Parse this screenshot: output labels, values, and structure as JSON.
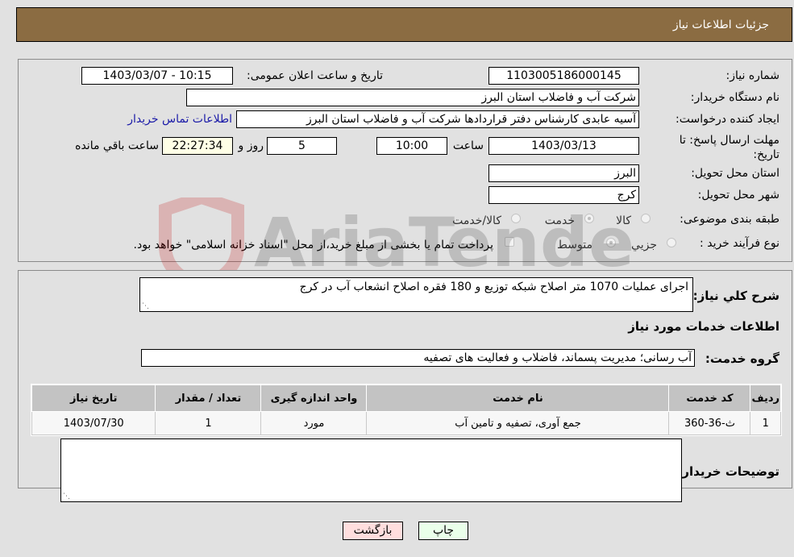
{
  "header": {
    "title": "جزئیات اطلاعات نیاز"
  },
  "details": {
    "need_number_label": "شماره نیاز:",
    "need_number": "1103005186000145",
    "announce_label": "تاریخ و ساعت اعلان عمومی:",
    "announce_value": "1403/03/07 - 10:15",
    "buyer_org_label": "نام دستگاه خریدار:",
    "buyer_org": "شرکت آب و فاضلاب استان البرز",
    "creator_label": "ایجاد کننده درخواست:",
    "creator": "آسیه عابدی کارشناس دفتر قراردادها شرکت آب و فاضلاب استان البرز",
    "contact_link": "اطلاعات تماس خریدار",
    "deadline_label": "مهلت ارسال پاسخ: تا تاریخ:",
    "deadline_date": "1403/03/13",
    "time_label": "ساعت",
    "deadline_time": "10:00",
    "days_value": "5",
    "days_label": "روز و",
    "remaining_time": "22:27:34",
    "remaining_label": "ساعت باقي مانده",
    "province_label": "استان محل تحویل:",
    "province": "البرز",
    "city_label": "شهر محل تحویل:",
    "city": "کرج",
    "category_label": "طبقه بندی موضوعی:",
    "category_options": [
      {
        "label": "کالا",
        "checked": false
      },
      {
        "label": "خدمت",
        "checked": true
      },
      {
        "label": "کالا/خدمت",
        "checked": false
      }
    ],
    "process_label": "نوع فرآیند خرید :",
    "process_options": [
      {
        "label": "جزیي",
        "checked": false
      },
      {
        "label": "متوسط",
        "checked": true
      }
    ],
    "treasury_note": "پرداخت تمام یا بخشی از مبلغ خرید،از محل \"اسناد خزانه اسلامی\" خواهد بود.",
    "treasury_checked": false
  },
  "description": {
    "label": "شرح کلي نیاز:",
    "value": "اجرای عملیات 1070 متر اصلاح شبکه توزیع و 180 فقره اصلاح انشعاب آب در کرج"
  },
  "services": {
    "section_title": "اطلاعات خدمات مورد نیاز",
    "group_label": "گروه خدمت:",
    "group_value": "آب رسانی؛ مدیریت پسماند، فاضلاب و فعالیت های تصفیه",
    "columns": [
      "ردیف",
      "کد خدمت",
      "نام خدمت",
      "واحد اندازه گیری",
      "تعداد / مقدار",
      "تاریخ نیاز"
    ],
    "rows": [
      [
        "1",
        "ث-36-360",
        "جمع آوری، تصفیه و تامین آب",
        "مورد",
        "1",
        "1403/07/30"
      ]
    ]
  },
  "buyer_notes": {
    "label": "توضیحات خریدار:",
    "value": ""
  },
  "buttons": {
    "print": "چاپ",
    "back": "بازگشت"
  },
  "watermark": {
    "text": "AriaTender.neT"
  },
  "colors": {
    "header_bg": "#8b6c42",
    "print_bg": "#eaffea",
    "back_bg": "#ffdede",
    "link": "#1a1aa8"
  }
}
